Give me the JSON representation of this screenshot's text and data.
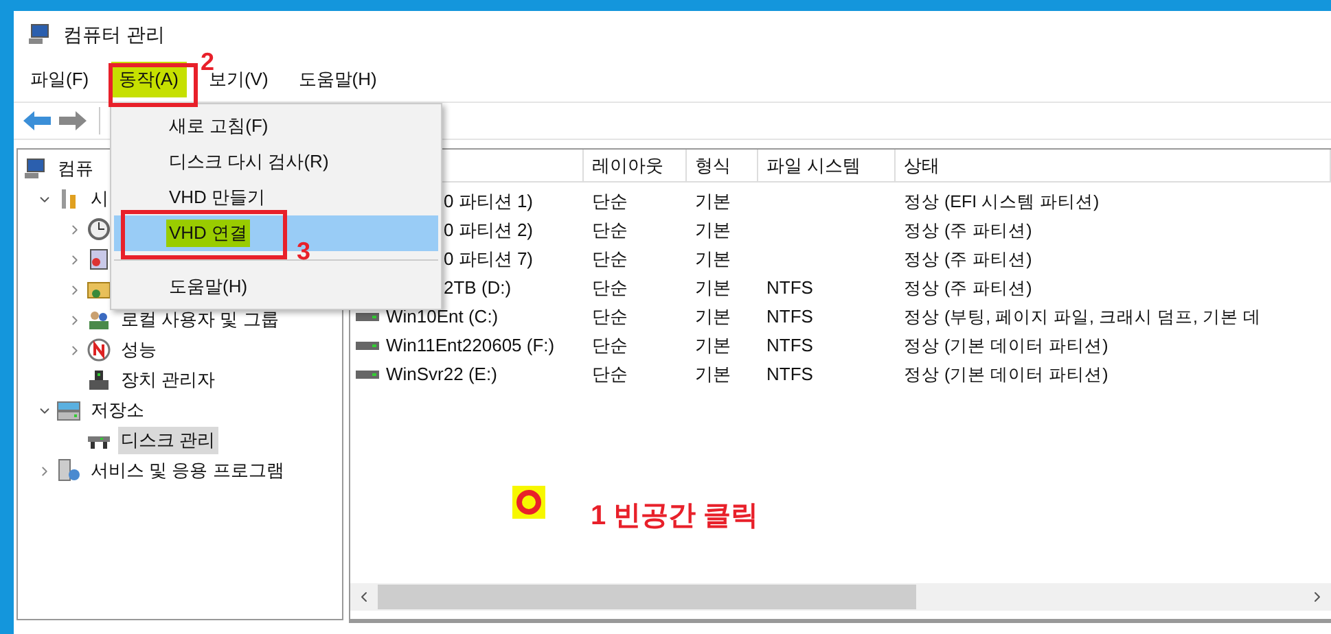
{
  "window": {
    "title": "컴퓨터 관리"
  },
  "menubar": [
    {
      "label": "파일(F)",
      "selected": false
    },
    {
      "label": "동작(A)",
      "selected": true
    },
    {
      "label": "보기(V)",
      "selected": false
    },
    {
      "label": "도움말(H)",
      "selected": false
    }
  ],
  "menu": [
    {
      "kind": "item",
      "label": "새로 고침(F)",
      "selected": false
    },
    {
      "kind": "item",
      "label": "디스크 다시 검사(R)",
      "selected": false
    },
    {
      "kind": "item",
      "label": "VHD 만들기",
      "selected": false
    },
    {
      "kind": "item",
      "label": "VHD 연결",
      "selected": true
    },
    {
      "kind": "separator"
    },
    {
      "kind": "item",
      "label": "도움말(H)",
      "selected": false
    }
  ],
  "tree": [
    {
      "label": "컴퓨",
      "selected": false,
      "children": [
        {
          "label": "시",
          "expanded": true,
          "selected": false,
          "children": [
            {
              "expanded": false
            },
            {
              "expanded": false
            },
            {
              "expanded": false
            },
            {
              "label": "로컬 사용자 및 그룹",
              "expanded": false,
              "selected": false
            },
            {
              "label": "성능",
              "expanded": false,
              "selected": false
            },
            {
              "label": "장치 관리자",
              "selected": false
            }
          ]
        },
        {
          "label": "저장소",
          "expanded": true,
          "selected": false,
          "children": [
            {
              "label": "디스크 관리",
              "selected": true
            }
          ]
        },
        {
          "label": "서비스 및 응용 프로그램",
          "expanded": false,
          "selected": false
        }
      ]
    }
  ],
  "table": {
    "columns": [
      "레이아웃",
      "형식",
      "파일 시스템",
      "상태"
    ],
    "rows": [
      {
        "kind": "covered",
        "volume": "0 파티션 1)",
        "layout": "단순",
        "type": "기본",
        "status": "정상 (EFI 시스템 파티션)"
      },
      {
        "kind": "covered",
        "volume": "0 파티션 2)",
        "layout": "단순",
        "type": "기본",
        "status": "정상 (주 파티션)"
      },
      {
        "kind": "covered",
        "volume": "0 파티션 7)",
        "layout": "단순",
        "type": "기본",
        "status": "정상 (주 파티션)"
      },
      {
        "kind": "covered",
        "volume": "2TB (D:)",
        "layout": "단순",
        "type": "기본",
        "fs": "NTFS",
        "status": "정상 (주 파티션)"
      },
      {
        "kind": "volume",
        "volume": "Win10Ent (C:)",
        "layout": "단순",
        "type": "기본",
        "fs": "NTFS",
        "status": "정상 (부팅, 페이지 파일, 크래시 덤프, 기본 데"
      },
      {
        "kind": "volume",
        "volume": "Win11Ent220605 (F:)",
        "layout": "단순",
        "type": "기본",
        "fs": "NTFS",
        "status": "정상 (기본 데이터 파티션)"
      },
      {
        "kind": "volume",
        "volume": "WinSvr22 (E:)",
        "layout": "단순",
        "type": "기본",
        "fs": "NTFS",
        "status": "정상 (기본 데이터 파티션)"
      }
    ]
  },
  "step_numbers": [
    "2",
    "3"
  ],
  "click_hint": "1 빈공간 클릭"
}
